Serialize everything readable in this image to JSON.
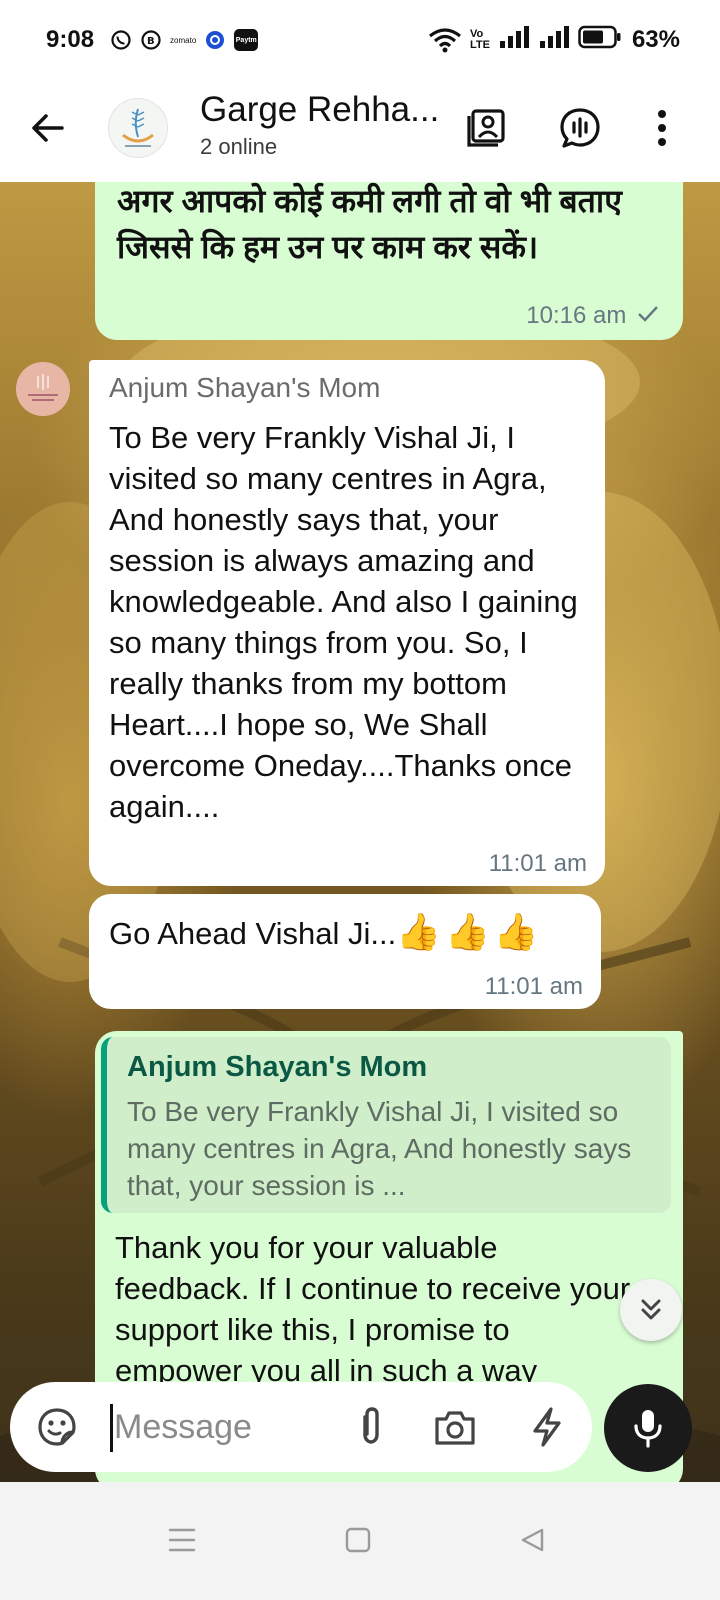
{
  "status_bar": {
    "time": "9:08",
    "notification_icons": [
      "whatsapp-icon",
      "whatsapp-business-icon",
      "zomato-icon",
      "app-icon",
      "paytm-icon"
    ],
    "zomato_label": "zomato",
    "paytm_label": "Paytm",
    "network_label_top": "Vo",
    "network_label_bottom": "LTE",
    "battery_percent": "63%"
  },
  "header": {
    "title": "Garge Rehha...",
    "subtitle": "2 online"
  },
  "messages": [
    {
      "direction": "outgoing",
      "text": "अगर आपको कोई कमी लगी तो वो भी बताए जिससे कि हम उन पर काम कर सकें।",
      "time": "10:16 am",
      "status_icon": "single-check-icon"
    },
    {
      "direction": "incoming",
      "sender": "Anjum Shayan's Mom",
      "text": "To Be very Frankly Vishal Ji, I visited so many centres in Agra, And honestly says that,  your session is always amazing and knowledgeable. And also I gaining so many things from you. So, I really thanks from my bottom Heart....I hope so, We Shall overcome Oneday....Thanks once again....",
      "time": "11:01 am"
    },
    {
      "direction": "incoming",
      "text": "Go Ahead Vishal Ji...",
      "emoji": "👍👍👍",
      "time": "11:01 am"
    },
    {
      "direction": "outgoing",
      "quoted_sender": "Anjum Shayan's Mom",
      "quoted_text": "To Be very Frankly Vishal Ji, I visited so many centres in Agra, And honestly says that,  your session is ...",
      "text": "Thank you for your valuable feedback. If I continue to receive your support like this, I promise to empower you all in such a way"
    }
  ],
  "composer": {
    "placeholder": "Message"
  },
  "colors": {
    "outgoing_bubble": "#d9fdd3",
    "incoming_bubble": "#ffffff",
    "quote_accent": "#06a07c",
    "quote_sender": "#0b5945",
    "mic_button": "#1a1a1a"
  }
}
